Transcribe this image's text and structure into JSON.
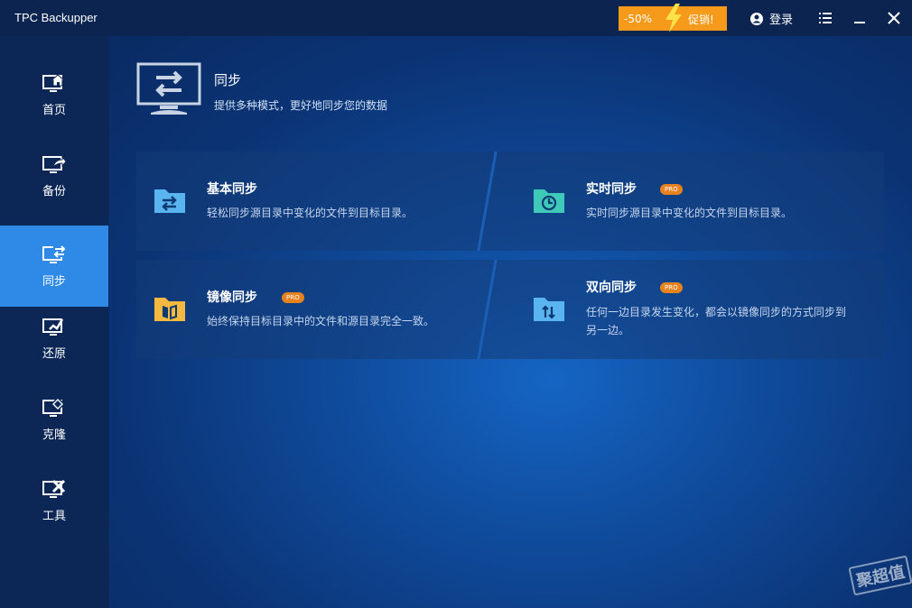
{
  "app": {
    "title": "TPC Backupper"
  },
  "promo": {
    "discount": "-50%",
    "label": "促销!"
  },
  "header": {
    "login_label": "登录"
  },
  "sidebar": {
    "items": [
      {
        "label": "首页",
        "icon": "home-icon"
      },
      {
        "label": "备份",
        "icon": "backup-icon"
      },
      {
        "label": "同步",
        "icon": "sync-icon",
        "active": true
      },
      {
        "label": "还原",
        "icon": "restore-icon"
      },
      {
        "label": "克隆",
        "icon": "clone-icon"
      },
      {
        "label": "工具",
        "icon": "tools-icon"
      }
    ]
  },
  "page": {
    "title": "同步",
    "subtitle": "提供多种模式，更好地同步您的数据"
  },
  "cards": [
    {
      "title": "基本同步",
      "desc": "轻松同步源目录中变化的文件到目标目录。",
      "pro": false,
      "icon": "basic-sync-folder-icon"
    },
    {
      "title": "实时同步",
      "desc": "实时同步源目录中变化的文件到目标目录。",
      "pro": true,
      "pro_label": "PRO",
      "icon": "realtime-sync-folder-icon"
    },
    {
      "title": "镜像同步",
      "desc": "始终保持目标目录中的文件和源目录完全一致。",
      "pro": true,
      "pro_label": "PRO",
      "icon": "mirror-sync-folder-icon"
    },
    {
      "title": "双向同步",
      "desc_line1": "任何一边目录发生变化，都会以镜像同步的方式同步到",
      "desc_line2": "另一边。",
      "pro": true,
      "pro_label": "PRO",
      "icon": "two-way-sync-folder-icon"
    }
  ],
  "watermark": "聚超值",
  "colors": {
    "accent": "#2e8ae6",
    "promo": "#f59a1b",
    "pro_badge": "#e8821e",
    "titlebar": "#0b2450",
    "sidebar": "#0c2755"
  }
}
